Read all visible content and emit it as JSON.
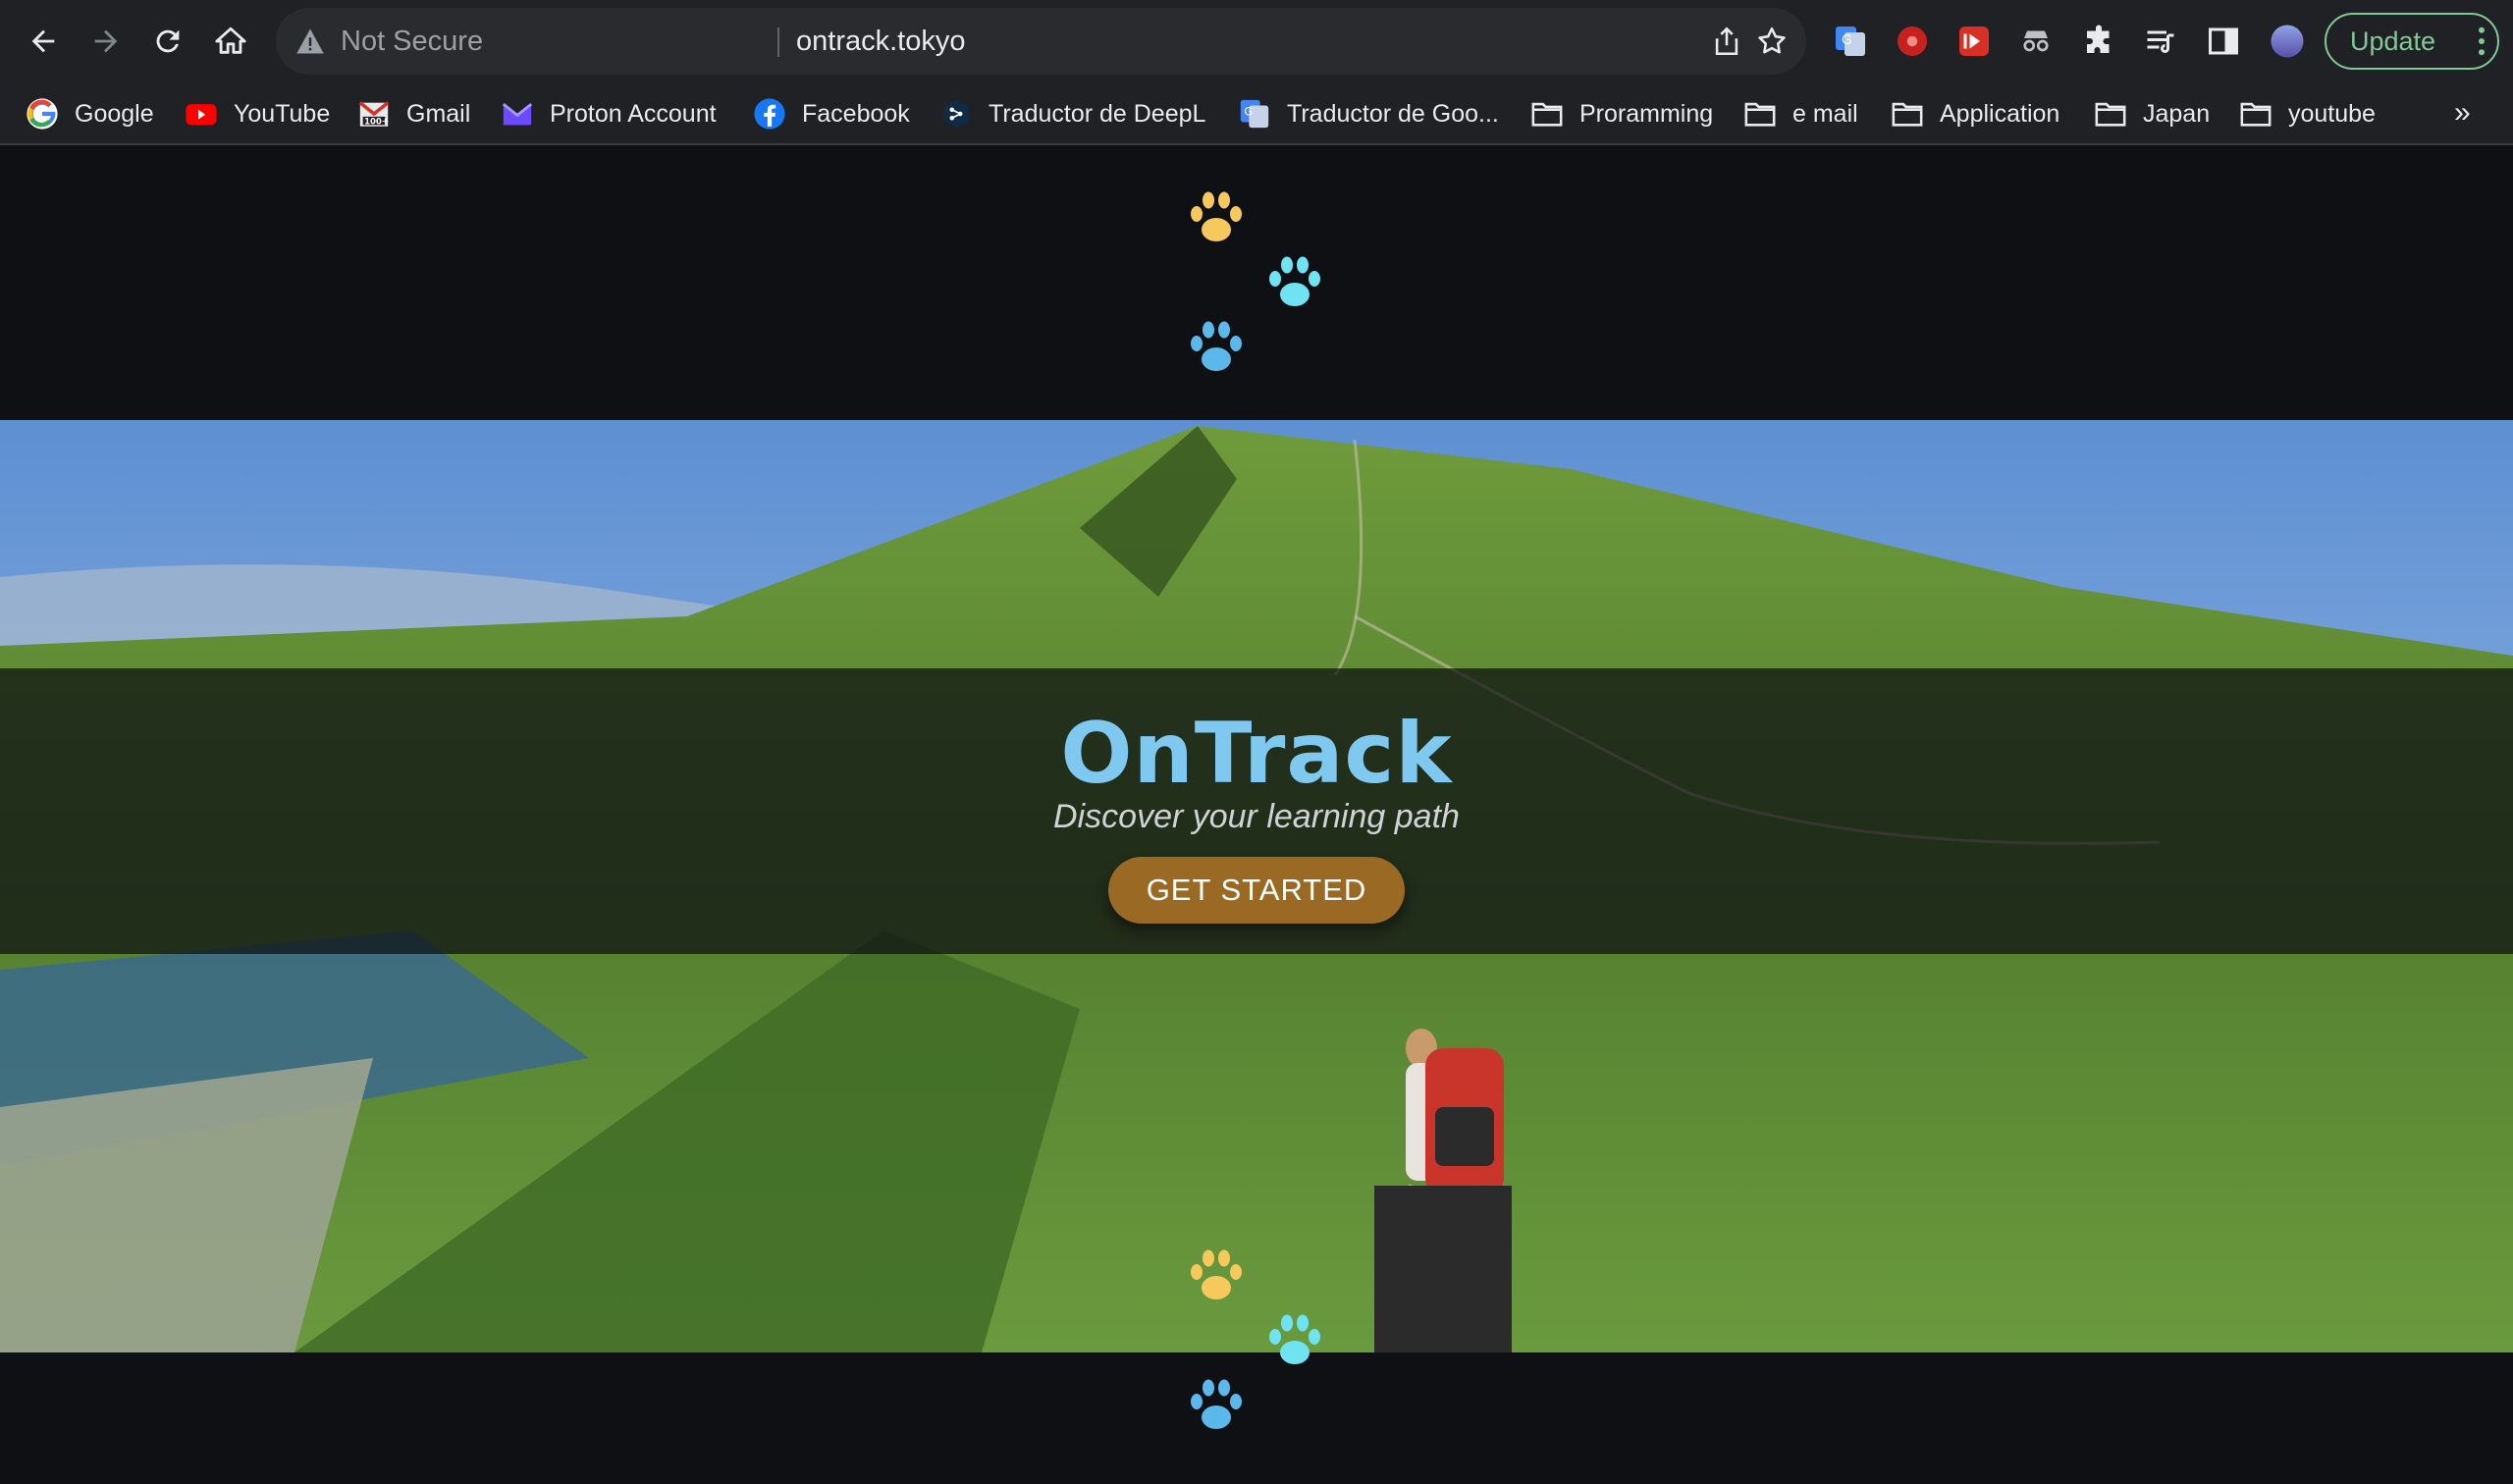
{
  "browser": {
    "security_label": "Not Secure",
    "url": "ontrack.tokyo",
    "update_label": "Update",
    "bookmarks": [
      {
        "label": "Google",
        "icon": "google-icon"
      },
      {
        "label": "YouTube",
        "icon": "youtube-icon"
      },
      {
        "label": "Gmail",
        "icon": "gmail-icon"
      },
      {
        "label": "Proton Account",
        "icon": "proton-icon"
      },
      {
        "label": "Facebook",
        "icon": "facebook-icon"
      },
      {
        "label": "Traductor de DeepL",
        "icon": "deepl-icon"
      },
      {
        "label": "Traductor de Goo...",
        "icon": "google-translate-icon"
      },
      {
        "label": "Proramming",
        "icon": "folder-icon"
      },
      {
        "label": "e mail",
        "icon": "folder-icon"
      },
      {
        "label": "Application",
        "icon": "folder-icon"
      },
      {
        "label": "Japan",
        "icon": "folder-icon"
      },
      {
        "label": "youtube",
        "icon": "folder-icon"
      }
    ],
    "more_bookmarks": "»"
  },
  "hero": {
    "title": "OnTrack",
    "subtitle": "Discover your learning path",
    "cta_label": "GET STARTED"
  },
  "colors": {
    "paw_yellow": "#f7c95c",
    "paw_cyan": "#6fe3f2",
    "paw_blue": "#5ab8ea",
    "title": "#7fc8ef",
    "cta": "#9a6a25"
  }
}
